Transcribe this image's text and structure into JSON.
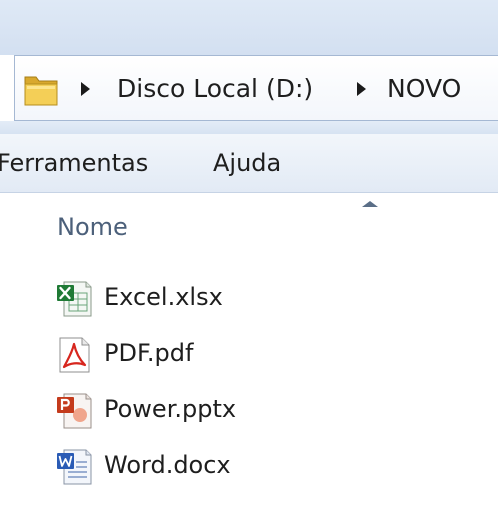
{
  "breadcrumb": {
    "items": [
      "Disco Local (D:)",
      "NOVO"
    ]
  },
  "menu": {
    "items": [
      "Ferramentas",
      "Ajuda"
    ]
  },
  "column_header": {
    "name_label": "Nome"
  },
  "files": [
    {
      "name": "Excel.xlsx",
      "icon": "excel-file-icon",
      "color": "#1f7a35"
    },
    {
      "name": "PDF.pdf",
      "icon": "pdf-file-icon",
      "color": "#d7261e"
    },
    {
      "name": "Power.pptx",
      "icon": "powerpoint-file-icon",
      "color": "#c43b1c"
    },
    {
      "name": "Word.docx",
      "icon": "word-file-icon",
      "color": "#2a5bb5"
    }
  ]
}
